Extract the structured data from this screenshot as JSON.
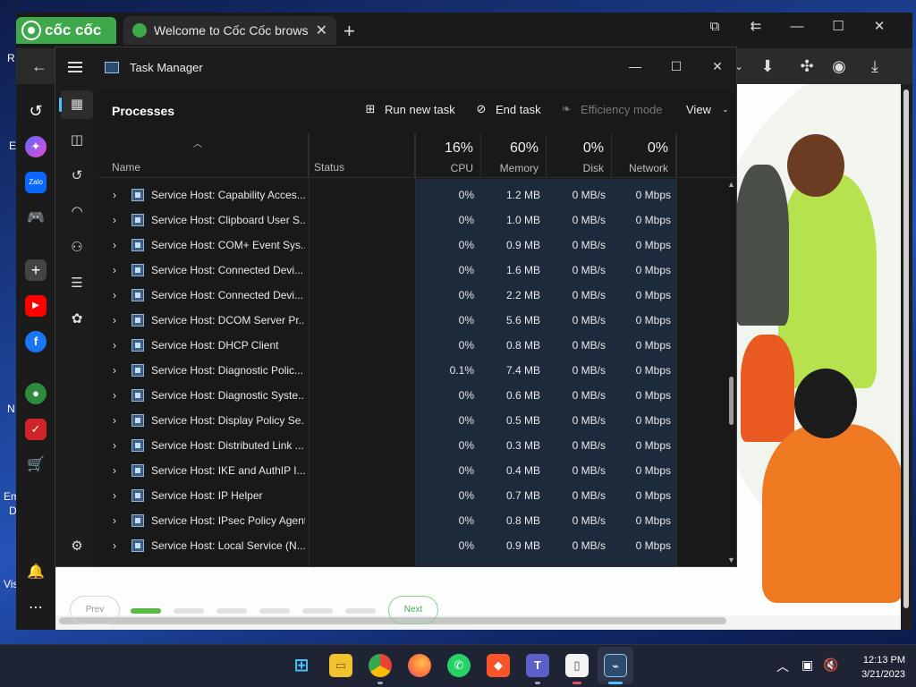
{
  "desktop": {
    "labels": [
      "R",
      "E",
      "N",
      "Em",
      "D",
      "Vis"
    ]
  },
  "browser": {
    "brand_name": "cốc cốc",
    "tab_title": "Welcome to Cốc Cốc browse",
    "tab_close": "✕",
    "new_tab": "+",
    "pager": {
      "prev": "Prev",
      "next": "Next"
    }
  },
  "task_manager": {
    "title": "Task Manager",
    "page_title": "Processes",
    "commands": {
      "run_new_task": "Run new task",
      "end_task": "End task",
      "efficiency_mode": "Efficiency mode",
      "view": "View"
    },
    "columns": {
      "name": "Name",
      "status": "Status",
      "cpu": {
        "pct": "16%",
        "label": "CPU"
      },
      "memory": {
        "pct": "60%",
        "label": "Memory"
      },
      "disk": {
        "pct": "0%",
        "label": "Disk"
      },
      "network": {
        "pct": "0%",
        "label": "Network"
      }
    },
    "processes": [
      {
        "name": "Service Host: Capability Acces...",
        "cpu": "0%",
        "memory": "1.2 MB",
        "disk": "0 MB/s",
        "network": "0 Mbps"
      },
      {
        "name": "Service Host: Clipboard User S...",
        "cpu": "0%",
        "memory": "1.0 MB",
        "disk": "0 MB/s",
        "network": "0 Mbps"
      },
      {
        "name": "Service Host: COM+ Event Sys...",
        "cpu": "0%",
        "memory": "0.9 MB",
        "disk": "0 MB/s",
        "network": "0 Mbps"
      },
      {
        "name": "Service Host: Connected Devi...",
        "cpu": "0%",
        "memory": "1.6 MB",
        "disk": "0 MB/s",
        "network": "0 Mbps"
      },
      {
        "name": "Service Host: Connected Devi...",
        "cpu": "0%",
        "memory": "2.2 MB",
        "disk": "0 MB/s",
        "network": "0 Mbps"
      },
      {
        "name": "Service Host: DCOM Server Pr...",
        "cpu": "0%",
        "memory": "5.6 MB",
        "disk": "0 MB/s",
        "network": "0 Mbps"
      },
      {
        "name": "Service Host: DHCP Client",
        "cpu": "0%",
        "memory": "0.8 MB",
        "disk": "0 MB/s",
        "network": "0 Mbps"
      },
      {
        "name": "Service Host: Diagnostic Polic...",
        "cpu": "0.1%",
        "memory": "7.4 MB",
        "disk": "0 MB/s",
        "network": "0 Mbps"
      },
      {
        "name": "Service Host: Diagnostic Syste...",
        "cpu": "0%",
        "memory": "0.6 MB",
        "disk": "0 MB/s",
        "network": "0 Mbps"
      },
      {
        "name": "Service Host: Display Policy Se...",
        "cpu": "0%",
        "memory": "0.5 MB",
        "disk": "0 MB/s",
        "network": "0 Mbps"
      },
      {
        "name": "Service Host: Distributed Link ...",
        "cpu": "0%",
        "memory": "0.3 MB",
        "disk": "0 MB/s",
        "network": "0 Mbps"
      },
      {
        "name": "Service Host: IKE and AuthIP I...",
        "cpu": "0%",
        "memory": "0.4 MB",
        "disk": "0 MB/s",
        "network": "0 Mbps"
      },
      {
        "name": "Service Host: IP Helper",
        "cpu": "0%",
        "memory": "0.7 MB",
        "disk": "0 MB/s",
        "network": "0 Mbps"
      },
      {
        "name": "Service Host: IPsec Policy Agent",
        "cpu": "0%",
        "memory": "0.8 MB",
        "disk": "0 MB/s",
        "network": "0 Mbps"
      },
      {
        "name": "Service Host: Local Service (N...",
        "cpu": "0%",
        "memory": "0.9 MB",
        "disk": "0 MB/s",
        "network": "0 Mbps"
      }
    ]
  },
  "taskbar": {
    "time": "12:13 PM",
    "date": "3/21/2023"
  }
}
